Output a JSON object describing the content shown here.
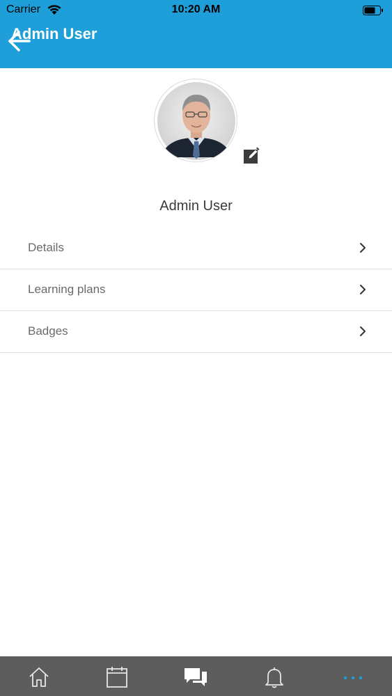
{
  "status_bar": {
    "carrier": "Carrier",
    "time": "10:20 AM",
    "icons": [
      "wifi-icon",
      "battery-icon"
    ]
  },
  "header": {
    "title": "Admin User",
    "back_icon": "back-arrow-icon",
    "background_color": "#1e9fd9"
  },
  "profile": {
    "name": "Admin User",
    "avatar_icon": "user-avatar",
    "edit_icon": "edit-icon"
  },
  "menu": {
    "items": [
      {
        "label": "Details",
        "icon": "chevron-right-icon"
      },
      {
        "label": "Learning plans",
        "icon": "chevron-right-icon"
      },
      {
        "label": "Badges",
        "icon": "chevron-right-icon"
      }
    ]
  },
  "tabbar": {
    "background_color": "#5d5d5d",
    "active_color": "#1e9fd9",
    "tabs": [
      {
        "icon": "home-icon",
        "active": false
      },
      {
        "icon": "calendar-icon",
        "active": false
      },
      {
        "icon": "messages-icon",
        "active": false
      },
      {
        "icon": "bell-icon",
        "active": false
      },
      {
        "icon": "more-icon",
        "active": true
      }
    ]
  }
}
